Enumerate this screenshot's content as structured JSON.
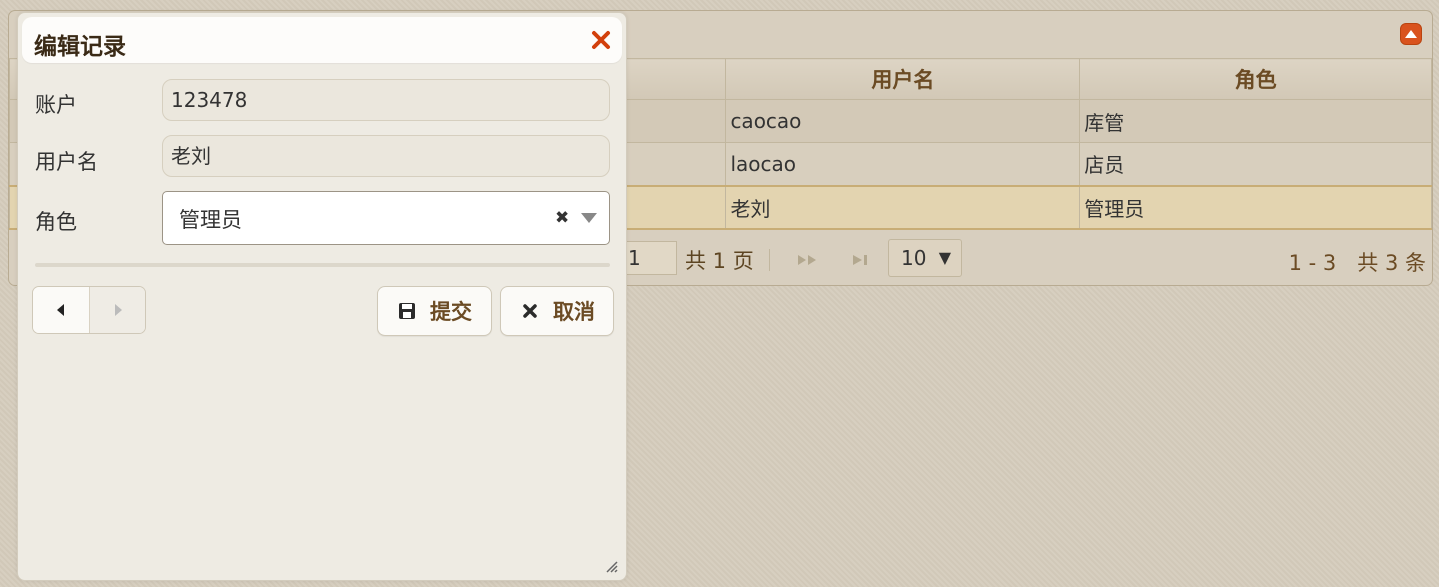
{
  "grid": {
    "columns": [
      "用户名",
      "角色"
    ],
    "rows": [
      {
        "username": "caocao",
        "role": "库管"
      },
      {
        "username": "laocao",
        "role": "店员"
      },
      {
        "username": "老刘",
        "role": "管理员"
      }
    ],
    "pager": {
      "current_page": "1",
      "total_pages_text": "共 1 页",
      "page_size": "10",
      "info_text": "1 - 3　共 3 条"
    }
  },
  "dialog": {
    "title": "编辑记录",
    "fields": {
      "account_label": "账户",
      "account_value": "123478",
      "username_label": "用户名",
      "username_value": "老刘",
      "role_label": "角色",
      "role_value": "管理员"
    },
    "buttons": {
      "submit": "提交",
      "cancel": "取消"
    }
  },
  "colors": {
    "accent": "#d9531e",
    "header_text": "#6b4b24",
    "selected_row": "#e3d4b0"
  }
}
